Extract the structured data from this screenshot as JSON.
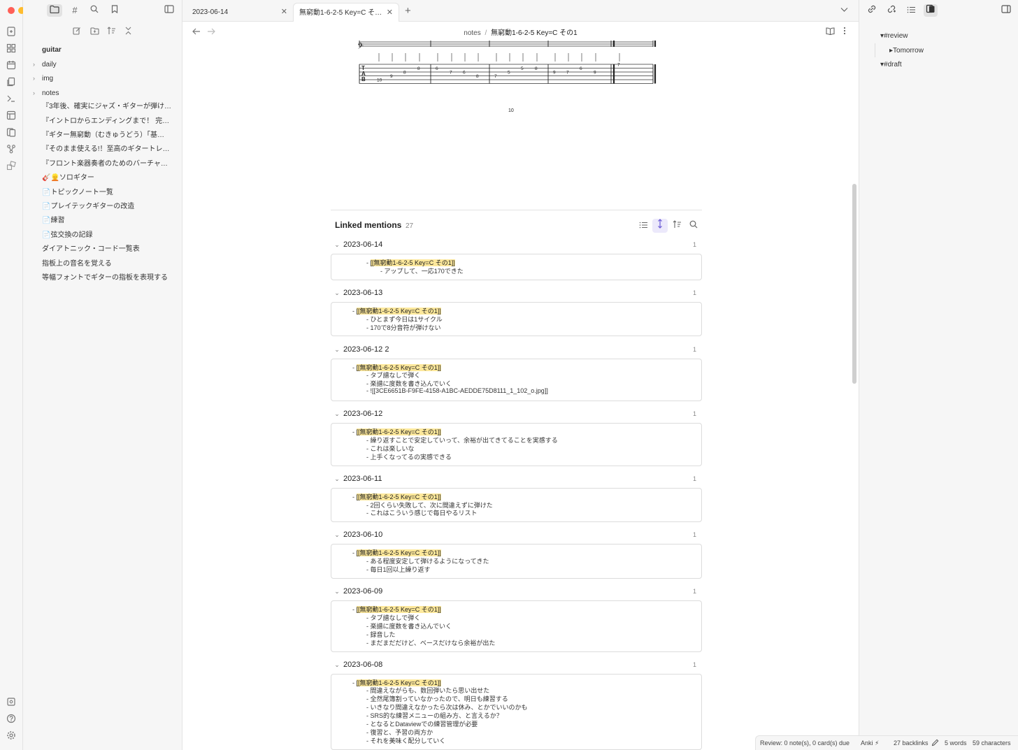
{
  "window": {
    "traffic_colors": [
      "#ff5f57",
      "#febc2e",
      "#28c840"
    ]
  },
  "ribbon": {
    "icons": [
      "open-quick-switcher-icon",
      "canvas-icon",
      "daily-note-icon",
      "templates-icon",
      "command-palette-icon",
      "kanban-icon",
      "anki-icon",
      "graph-icon",
      "plugins-icon"
    ],
    "bottom_icons": [
      "vault-switcher-icon",
      "help-icon",
      "settings-icon"
    ]
  },
  "explorer": {
    "vault_name": "guitar",
    "items": [
      {
        "label": "daily",
        "folder": true
      },
      {
        "label": "img",
        "folder": true
      },
      {
        "label": "notes",
        "folder": true
      },
      {
        "label": "『3年後、確実にジャズ・ギターが弾け…",
        "folder": false
      },
      {
        "label": "『イントロからエンディングまで！ 完…",
        "folder": false
      },
      {
        "label": "『ギター無窮動（むきゅうどう）「基…",
        "folder": false
      },
      {
        "label": "『そのまま使える!！至高のギタートレ…",
        "folder": false
      },
      {
        "label": "『フロント楽器奏者のためのバーチャル…",
        "folder": false
      },
      {
        "label": "🎸👱ソロギター",
        "folder": false
      },
      {
        "label": "📄トピックノート一覧",
        "folder": false
      },
      {
        "label": "📄プレイテックギターの改造",
        "folder": false
      },
      {
        "label": "📄練習",
        "folder": false
      },
      {
        "label": "📄弦交換の記録",
        "folder": false
      },
      {
        "label": "ダイアトニック・コード一覧表",
        "folder": false
      },
      {
        "label": "指板上の音名を覚える",
        "folder": false
      },
      {
        "label": "等幅フォントでギターの指板を表現する",
        "folder": false
      }
    ]
  },
  "tabs": [
    {
      "label": "2023-06-14",
      "active": false
    },
    {
      "label": "無窮動1-6-2-5 Key=C そ…",
      "active": true
    }
  ],
  "breadcrumb": {
    "folder": "notes",
    "separator": "/",
    "note": "無窮動1-6-2-5 Key=C その1"
  },
  "tab_notation": {
    "page_number": "10",
    "string_labels": [
      "T",
      "A",
      "B"
    ],
    "notes": [
      "10",
      "9",
      "8",
      "8",
      "6",
      "7",
      "6",
      "8",
      "7",
      "5",
      "5",
      "8",
      "9",
      "7",
      "6",
      "9",
      "7"
    ]
  },
  "right_sidebar": {
    "tags": [
      {
        "label": "▾#review",
        "indent": 0
      },
      {
        "label": "▸Tomorrow",
        "indent": 1
      },
      {
        "label": "▾#draft",
        "indent": 0
      }
    ]
  },
  "linked_mentions": {
    "title": "Linked mentions",
    "count": "27",
    "link_text": "[[無窮動1-6-2-5 Key=C その1]]",
    "groups": [
      {
        "date": "2023-06-14",
        "count": "1",
        "nested": true,
        "lines": [
          "- アップして、一応170できた"
        ]
      },
      {
        "date": "2023-06-13",
        "count": "1",
        "nested": false,
        "lines": [
          "- ひとまず今日は1サイクル",
          "- 170で8分音符が弾けない"
        ]
      },
      {
        "date": "2023-06-12 2",
        "count": "1",
        "nested": false,
        "lines": [
          "- タブ譜なしで弾く",
          "- 楽譜に度数を書き込んでいく",
          "- ![[3CE6651B-F9FE-4158-A1BC-AEDDE75D8111_1_102_o.jpg]]"
        ]
      },
      {
        "date": "2023-06-12",
        "count": "1",
        "nested": false,
        "lines": [
          "- 繰り返すことで安定していって、余裕が出てきてることを実感する",
          "- これは楽しいな",
          "- 上手くなってるの実感できる"
        ]
      },
      {
        "date": "2023-06-11",
        "count": "1",
        "nested": false,
        "lines": [
          "- 2回くらい失敗して、次に間違えずに弾けた",
          "- これはこういう感じで毎日やるリスト"
        ]
      },
      {
        "date": "2023-06-10",
        "count": "1",
        "nested": false,
        "lines": [
          "- ある程度安定して弾けるようになってきた",
          "- 毎日1回以上繰り返す"
        ]
      },
      {
        "date": "2023-06-09",
        "count": "1",
        "nested": false,
        "lines": [
          "- タブ譜なしで弾く",
          "- 楽譜に度数を書き込んでいく",
          "- 録音した",
          "- まだまだだけど、ベースだけなら余裕が出た"
        ]
      },
      {
        "date": "2023-06-08",
        "count": "1",
        "nested": false,
        "lines": [
          "- 間違えながらも、数回弾いたら思い出せた",
          "- 全然尾簿割っていなかったので、明日も練習する",
          "- いきなり間違えなかったら次は休み、とかでいいのかも",
          "- SRS的な練習メニューの組み方、と言えるか？",
          "- となるとDataviewでの練習管理が必要",
          "- 復習と、予習の両方か",
          "- それを美味く配分していく"
        ]
      }
    ]
  },
  "status_bar": {
    "review": "Review: 0 note(s), 0 card(s) due",
    "anki": "Anki ⚡",
    "backlinks": "27 backlinks",
    "words": "5 words",
    "characters": "59 characters"
  }
}
